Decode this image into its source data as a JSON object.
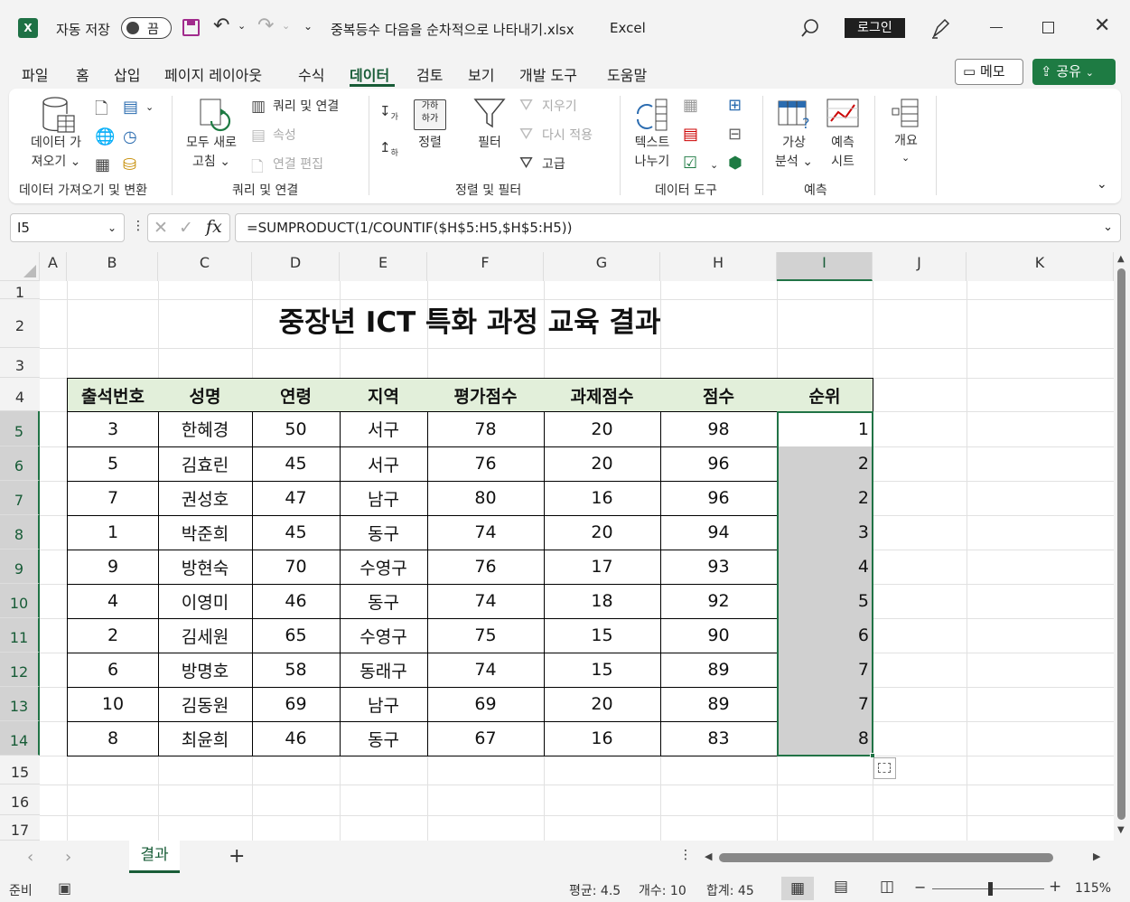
{
  "titlebar": {
    "autosave_label": "자동 저장",
    "autosave_state": "끔",
    "filename": "중복등수 다음을 순차적으로 나타내기.xlsx",
    "app": "Excel",
    "login": "로그인"
  },
  "menu": {
    "tabs": [
      "파일",
      "홈",
      "삽입",
      "페이지 레이아웃",
      "수식",
      "데이터",
      "검토",
      "보기",
      "개발 도구",
      "도움말"
    ],
    "active": "데이터",
    "memo": "메모",
    "share": "공유"
  },
  "ribbon": {
    "get_data": [
      "데이터 가",
      "져오기 ⌄"
    ],
    "group_get": "데이터 가져오기 및 변환",
    "refresh_all": [
      "모두 새로",
      "고침 ⌄"
    ],
    "queries_connections": "쿼리 및 연결",
    "properties": "속성",
    "edit_links": "연결 편집",
    "group_queries": "쿼리 및 연결",
    "sort": "정렬",
    "filter": "필터",
    "clear": "지우기",
    "reapply": "다시 적용",
    "advanced": "고급",
    "group_sort": "정렬 및 필터",
    "text_to_columns": [
      "텍스트",
      "나누기"
    ],
    "group_tools": "데이터 도구",
    "what_if": [
      "가상",
      "분석 ⌄"
    ],
    "forecast_sheet": [
      "예측",
      "시트"
    ],
    "group_forecast": "예측",
    "outline": "개요"
  },
  "formula_bar": {
    "name_box": "I5",
    "fx": "fx",
    "formula": "=SUMPRODUCT(1/COUNTIF($H$5:H5,$H$5:H5))"
  },
  "sheet": {
    "columns": [
      "A",
      "B",
      "C",
      "D",
      "E",
      "F",
      "G",
      "H",
      "I",
      "J",
      "K"
    ],
    "rows": [
      "1",
      "2",
      "3",
      "4",
      "5",
      "6",
      "7",
      "8",
      "9",
      "10",
      "11",
      "12",
      "13",
      "14",
      "15",
      "16",
      "17"
    ],
    "title": "중장년 ICT 특화 과정 교육 결과",
    "headers": [
      "출석번호",
      "성명",
      "연령",
      "지역",
      "평가점수",
      "과제점수",
      "점수",
      "순위"
    ],
    "data": [
      [
        "3",
        "한혜경",
        "50",
        "서구",
        "78",
        "20",
        "98",
        "1"
      ],
      [
        "5",
        "김효린",
        "45",
        "서구",
        "76",
        "20",
        "96",
        "2"
      ],
      [
        "7",
        "권성호",
        "47",
        "남구",
        "80",
        "16",
        "96",
        "2"
      ],
      [
        "1",
        "박준희",
        "45",
        "동구",
        "74",
        "20",
        "94",
        "3"
      ],
      [
        "9",
        "방현숙",
        "70",
        "수영구",
        "76",
        "17",
        "93",
        "4"
      ],
      [
        "4",
        "이영미",
        "46",
        "동구",
        "74",
        "18",
        "92",
        "5"
      ],
      [
        "2",
        "김세원",
        "65",
        "수영구",
        "75",
        "15",
        "90",
        "6"
      ],
      [
        "6",
        "방명호",
        "58",
        "동래구",
        "74",
        "15",
        "89",
        "7"
      ],
      [
        "10",
        "김동원",
        "69",
        "남구",
        "69",
        "20",
        "89",
        "7"
      ],
      [
        "8",
        "최윤희",
        "46",
        "동구",
        "67",
        "16",
        "83",
        "8"
      ]
    ],
    "tab": "결과"
  },
  "status": {
    "ready": "준비",
    "average": "평균: 4.5",
    "count": "개수: 10",
    "sum": "합계: 45",
    "zoom": "115%"
  },
  "colors": {
    "accent": "#217346",
    "share_bg": "#1e7b43",
    "header_fill": "#e2efda",
    "selected_fill": "#d0d0d0"
  }
}
